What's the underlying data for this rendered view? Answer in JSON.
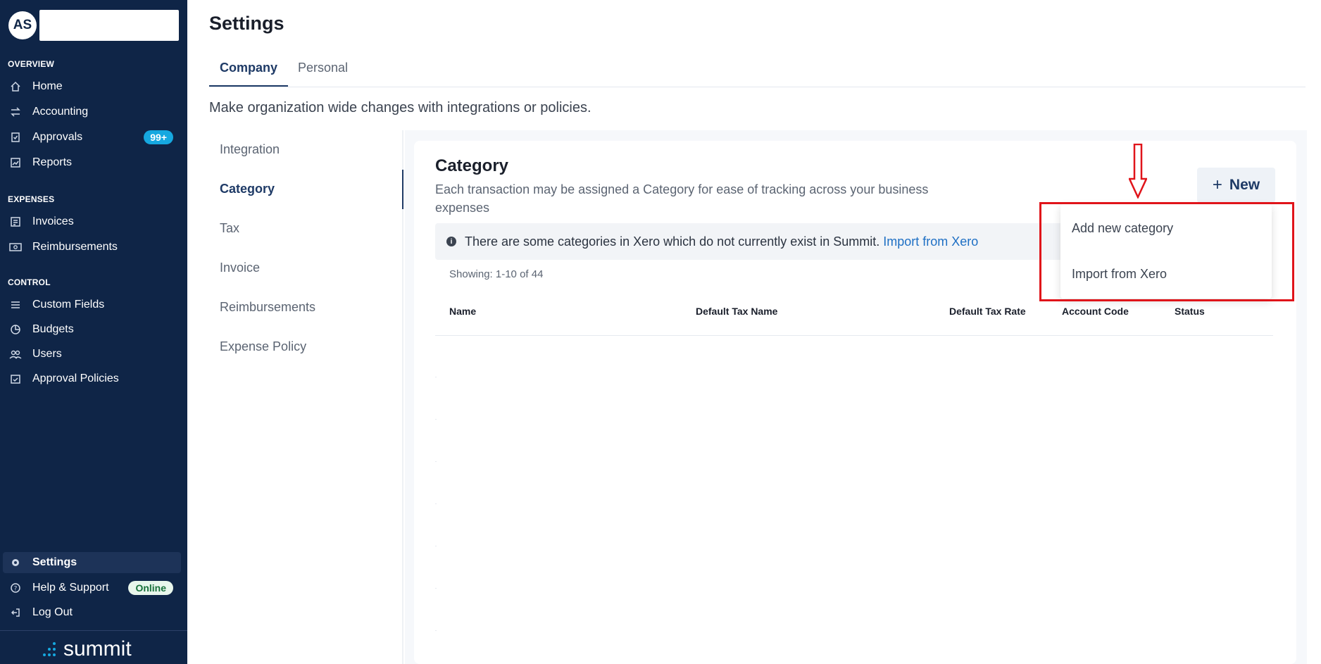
{
  "user": {
    "initials": "AS"
  },
  "sidebar": {
    "sections": {
      "overview": "OVERVIEW",
      "expenses": "EXPENSES",
      "control": "CONTROL"
    },
    "items": {
      "home": "Home",
      "accounting": "Accounting",
      "approvals": "Approvals",
      "reports": "Reports",
      "invoices": "Invoices",
      "reimbursements": "Reimbursements",
      "custom_fields": "Custom Fields",
      "budgets": "Budgets",
      "users": "Users",
      "approval_policies": "Approval Policies",
      "settings": "Settings",
      "help_support": "Help & Support",
      "log_out": "Log Out"
    },
    "approvals_badge": "99+",
    "online_badge": "Online",
    "logo_text": "summit"
  },
  "page": {
    "title": "Settings",
    "tabs": [
      "Company",
      "Personal"
    ],
    "subtitle": "Make organization wide changes with integrations or policies."
  },
  "settings_nav": [
    "Integration",
    "Category",
    "Tax",
    "Invoice",
    "Reimbursements",
    "Expense Policy"
  ],
  "category": {
    "title": "Category",
    "description": "Each transaction may be assigned a Category for ease of tracking across your business expenses",
    "new_button": "New",
    "info_text": "There are some categories in Xero which do not currently exist in Summit.",
    "info_link": "Import from Xero",
    "showing": "Showing: 1-10 of 44",
    "columns": [
      "Name",
      "Default Tax Name",
      "Default Tax Rate",
      "Account Code",
      "Status"
    ]
  },
  "dropdown": {
    "items": [
      "Add new category",
      "Import from Xero"
    ]
  },
  "colors": {
    "sidebar_bg": "#0f2547",
    "accent": "#1e3a66",
    "annotation_red": "#e0141a"
  }
}
